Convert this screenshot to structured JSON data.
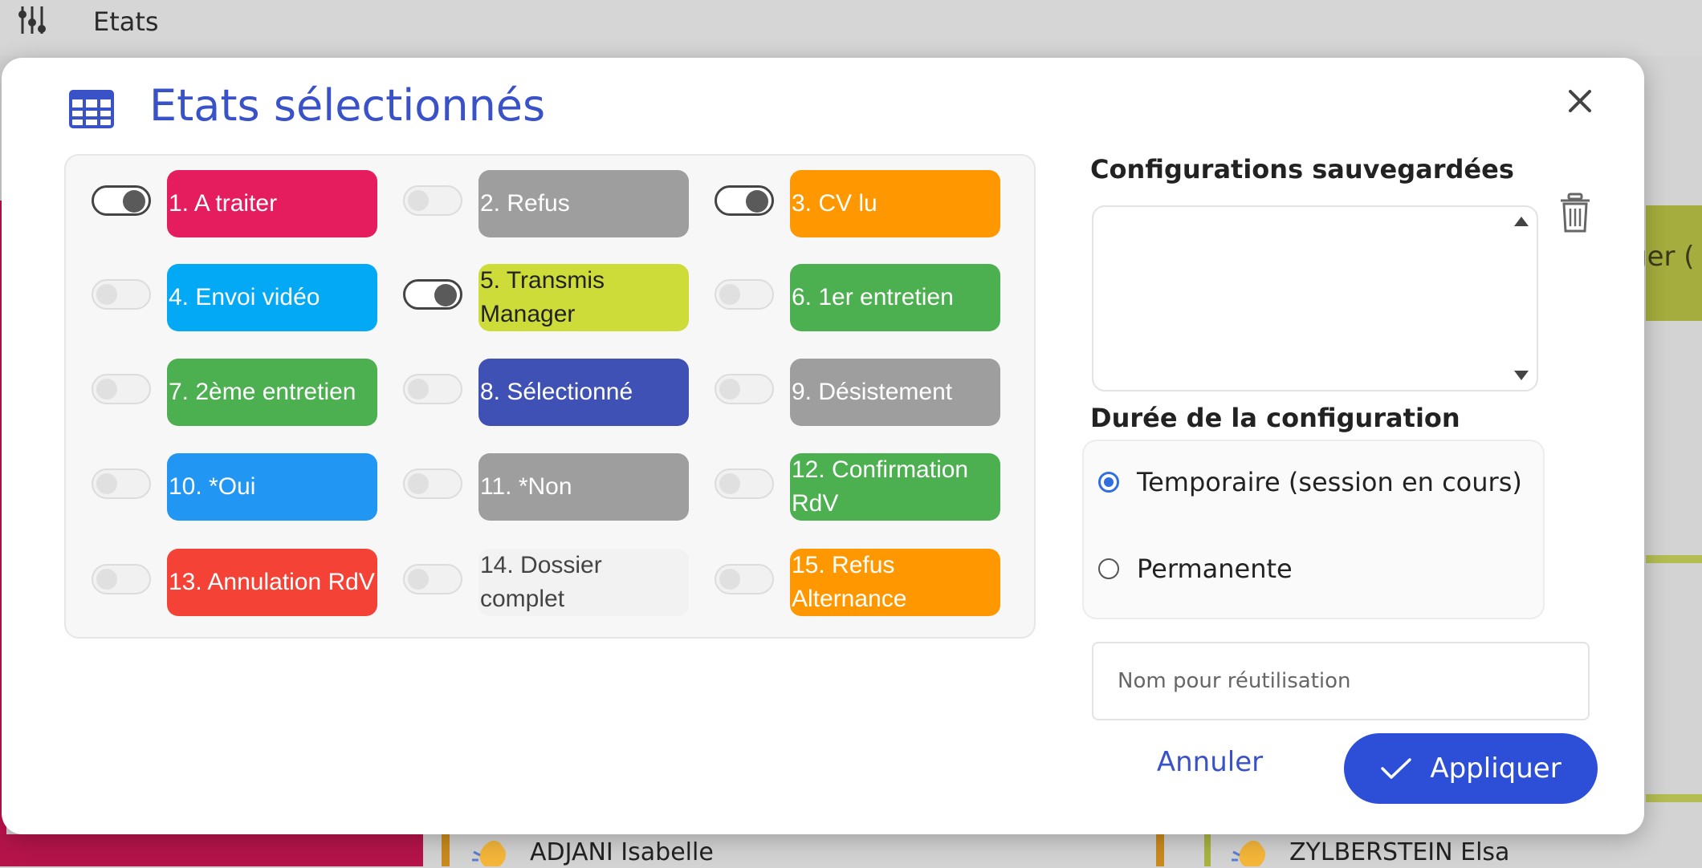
{
  "topbar": {
    "title": "Etats"
  },
  "background": {
    "people": [
      "ADJANI Isabelle",
      "ZYLBERSTEIN Elsa"
    ],
    "right_partial_text": "ger ("
  },
  "modal": {
    "title": "Etats sélectionnés",
    "states": [
      {
        "label": "1. A traiter",
        "color": "#e51d5e",
        "text_color": "#ffffff",
        "on": true
      },
      {
        "label": "2. Refus",
        "color": "#9e9e9e",
        "text_color": "#ffffff",
        "on": false
      },
      {
        "label": "3. CV lu",
        "color": "#ff9800",
        "text_color": "#ffffff",
        "on": true
      },
      {
        "label": "4. Envoi vidéo",
        "color": "#03a9f4",
        "text_color": "#ffffff",
        "on": false
      },
      {
        "label": "5. Transmis Manager",
        "color": "#cddc39",
        "text_color": "#222222",
        "on": true
      },
      {
        "label": "6. 1er entretien",
        "color": "#4caf50",
        "text_color": "#ffffff",
        "on": false
      },
      {
        "label": "7. 2ème entretien",
        "color": "#4caf50",
        "text_color": "#ffffff",
        "on": false
      },
      {
        "label": "8. Sélectionné",
        "color": "#3f51b5",
        "text_color": "#ffffff",
        "on": false
      },
      {
        "label": "9. Désistement",
        "color": "#9e9e9e",
        "text_color": "#ffffff",
        "on": false
      },
      {
        "label": "10. *Oui",
        "color": "#2196f3",
        "text_color": "#ffffff",
        "on": false
      },
      {
        "label": "11. *Non",
        "color": "#9e9e9e",
        "text_color": "#ffffff",
        "on": false
      },
      {
        "label": "12. Confirmation RdV",
        "color": "#4caf50",
        "text_color": "#ffffff",
        "on": false
      },
      {
        "label": "13. Annulation RdV",
        "color": "#f44336",
        "text_color": "#ffffff",
        "on": false
      },
      {
        "label": "14. Dossier complet",
        "color": "#f2f2f2",
        "text_color": "#444444",
        "on": false
      },
      {
        "label": "15. Refus Alternance",
        "color": "#ff9800",
        "text_color": "#ffffff",
        "on": false
      }
    ],
    "saved": {
      "title": "Configurations sauvegardées"
    },
    "duration": {
      "title": "Durée de la configuration",
      "options": [
        {
          "label": "Temporaire (session en cours)",
          "checked": true
        },
        {
          "label": "Permanente",
          "checked": false
        }
      ]
    },
    "name_input": {
      "placeholder": "Nom pour réutilisation",
      "value": ""
    },
    "cancel_label": "Annuler",
    "apply_label": "Appliquer"
  },
  "colors": {
    "accent": "#3a52c8",
    "apply_button": "#2d4fd8",
    "radio_checked": "#2f6fe0"
  }
}
